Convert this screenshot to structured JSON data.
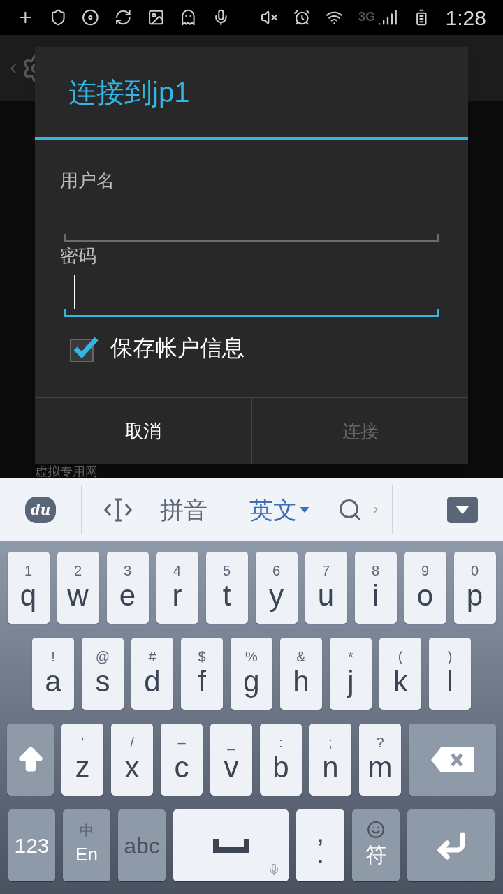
{
  "status_bar": {
    "network": "3G",
    "time": "1:28"
  },
  "background": {
    "list_item": "虚拟专用网"
  },
  "dialog": {
    "title": "连接到jp1",
    "fields": [
      {
        "label": "用户名",
        "focused": false
      },
      {
        "label": "密码",
        "focused": true
      }
    ],
    "checkbox": {
      "label": "保存帐户信息",
      "checked": true
    },
    "buttons": [
      {
        "label": "取消",
        "disabled": false
      },
      {
        "label": "连接",
        "disabled": true
      }
    ]
  },
  "keyboard": {
    "toolbar": [
      {
        "kind": "logo",
        "label": "du"
      },
      {
        "kind": "cursor"
      },
      {
        "kind": "mode",
        "label": "拼音",
        "selected": false
      },
      {
        "kind": "mode",
        "label": "英文",
        "selected": true
      },
      {
        "kind": "search"
      },
      {
        "kind": "hide"
      }
    ],
    "rows": [
      {
        "keys": [
          {
            "kind": "letter",
            "hint": "1",
            "main": "q"
          },
          {
            "kind": "letter",
            "hint": "2",
            "main": "w"
          },
          {
            "kind": "letter",
            "hint": "3",
            "main": "e"
          },
          {
            "kind": "letter",
            "hint": "4",
            "main": "r"
          },
          {
            "kind": "letter",
            "hint": "5",
            "main": "t"
          },
          {
            "kind": "letter",
            "hint": "6",
            "main": "y"
          },
          {
            "kind": "letter",
            "hint": "7",
            "main": "u"
          },
          {
            "kind": "letter",
            "hint": "8",
            "main": "i"
          },
          {
            "kind": "letter",
            "hint": "9",
            "main": "o"
          },
          {
            "kind": "letter",
            "hint": "0",
            "main": "p"
          }
        ]
      },
      {
        "keys": [
          {
            "kind": "letter",
            "hint": "!",
            "main": "a"
          },
          {
            "kind": "letter",
            "hint": "@",
            "main": "s"
          },
          {
            "kind": "letter",
            "hint": "#",
            "main": "d"
          },
          {
            "kind": "letter",
            "hint": "$",
            "main": "f"
          },
          {
            "kind": "letter",
            "hint": "%",
            "main": "g"
          },
          {
            "kind": "letter",
            "hint": "&",
            "main": "h"
          },
          {
            "kind": "letter",
            "hint": "*",
            "main": "j"
          },
          {
            "kind": "letter",
            "hint": "(",
            "main": "k"
          },
          {
            "kind": "letter",
            "hint": ")",
            "main": "l"
          }
        ]
      },
      {
        "keys": [
          {
            "kind": "shift"
          },
          {
            "kind": "letter",
            "hint": "′",
            "main": "z"
          },
          {
            "kind": "letter",
            "hint": "/",
            "main": "x"
          },
          {
            "kind": "letter",
            "hint": "–",
            "main": "c"
          },
          {
            "kind": "letter",
            "hint": "_",
            "main": "v"
          },
          {
            "kind": "letter",
            "hint": ":",
            "main": "b"
          },
          {
            "kind": "letter",
            "hint": ";",
            "main": "n"
          },
          {
            "kind": "letter",
            "hint": "?",
            "main": "m"
          },
          {
            "kind": "backspace"
          }
        ]
      },
      {
        "keys": [
          {
            "kind": "numbers",
            "main": "123"
          },
          {
            "kind": "language",
            "hint": "中",
            "main": "En"
          },
          {
            "kind": "alpha",
            "main": "abc"
          },
          {
            "kind": "space"
          },
          {
            "kind": "punct",
            "hint": ",",
            "main": "."
          },
          {
            "kind": "symbol",
            "main": "符"
          },
          {
            "kind": "enter"
          }
        ]
      }
    ]
  }
}
